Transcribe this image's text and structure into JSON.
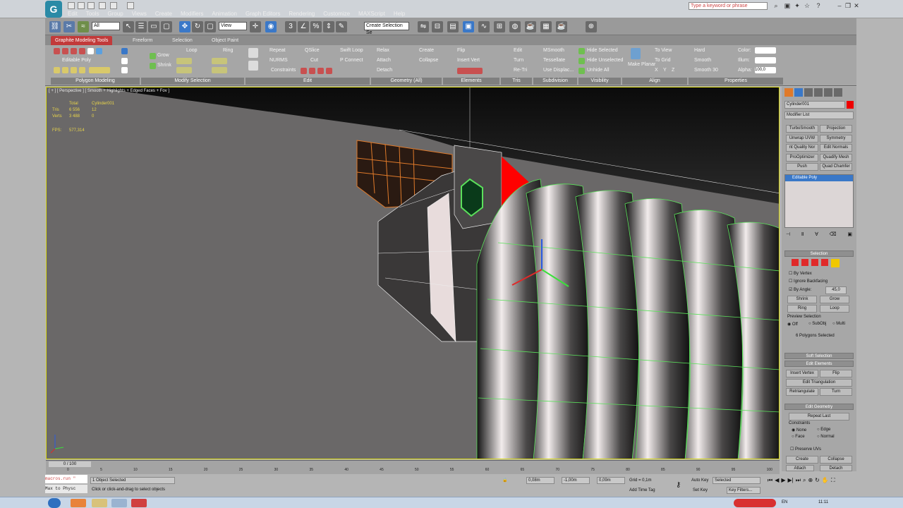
{
  "title_bar": {
    "search_placeholder": "Type a keyword or phrase",
    "app_letter": "G"
  },
  "menu": [
    "Edit",
    "Tools",
    "Group",
    "Views",
    "Create",
    "Modifiers",
    "Animation",
    "Graph Editors",
    "Rendering",
    "Customize",
    "MAXScript",
    "Help"
  ],
  "toolbar": {
    "filter_value": "All",
    "view_value": "View",
    "selection_set_value": "Create Selection Se"
  },
  "ribbon": {
    "tabs": [
      "Graphite Modeling Tools",
      "Freeform",
      "Selection",
      "Object Paint"
    ],
    "editable_poly_label": "Editable Poly",
    "panels": [
      "Polygon Modeling",
      "Modify Selection",
      "Edit",
      "Geometry (All)",
      "Elements",
      "Tris",
      "Subdivision",
      "Visibility",
      "Align",
      "Properties"
    ],
    "modify_sel": [
      "Grow",
      "Shrink",
      "Loop",
      "Ring"
    ],
    "edit": [
      "Repeat",
      "QSlice",
      "Swift Loop",
      "NURMS",
      "Cut",
      "P Connect",
      "Constraints"
    ],
    "geometry": [
      "Relax",
      "Create",
      "Attach",
      "Collapse",
      "Detach"
    ],
    "elements": [
      "Flip",
      "Insert Vert"
    ],
    "tris": [
      "Edit",
      "Turn",
      "Re-Tri"
    ],
    "subdivision": [
      "MSmooth",
      "Tessellate",
      "Use Displac..."
    ],
    "visibility": [
      "Hide Selected",
      "Hide Unselected",
      "Unhide All"
    ],
    "align": [
      "Make Planar"
    ],
    "align2": [
      "To View",
      "To Grid",
      "X",
      "Y",
      "Z"
    ],
    "properties": [
      "Hard",
      "Smooth",
      "Smooth 30",
      "Color:",
      "Illum:",
      "Alpha:"
    ],
    "alpha_value": "100,0"
  },
  "viewport": {
    "label": "[ + ] [ Perspective ] [ Smooth + Highlights + Edged Faces + Fov ]",
    "stats": {
      "total_label": "Total",
      "obj_label": "Cylinder001",
      "tris_label": "Tris",
      "tris_total": "6 556",
      "tris_obj": "12",
      "verts_label": "Verts",
      "verts_total": "3 488",
      "verts_obj": "0",
      "fps_label": "FPS:",
      "fps_value": "577,314"
    }
  },
  "command_panel": {
    "object_name": "Cylinder001",
    "modifier_list": "Modifier List",
    "modifier_buttons": [
      "TurboSmooth",
      "Projection",
      "Unwrap UVW",
      "Symmetry",
      "nt Quality Nor",
      "Edit Normals",
      "ProOptimizer",
      "Quadify Mesh",
      "Push",
      "Quad Chamfer"
    ],
    "stack_item": "Editable Poly",
    "selection_header": "Selection",
    "by_vertex": "By Vertex",
    "ignore_backfacing": "Ignore Backfacing",
    "by_angle": "By Angle:",
    "angle_value": "45,0",
    "shrink": "Shrink",
    "grow": "Grow",
    "ring": "Ring",
    "loop": "Loop",
    "preview_header": "Preview Selection",
    "preview_opts": [
      "Off",
      "SubObj",
      "Multi"
    ],
    "selected_info": "6 Polygons Selected",
    "soft_sel": "Soft Selection",
    "edit_elements": "Edit Elements",
    "insert_vertex": "Insert Vertex",
    "flip": "Flip",
    "edit_triangulation": "Edit Triangulation",
    "retriangulate": "Retriangulate",
    "turn": "Turn",
    "edit_geometry": "Edit Geometry",
    "repeat_last": "Repeat Last",
    "constraints": "Constraints",
    "con_opts": [
      "None",
      "Edge",
      "Face",
      "Normal"
    ],
    "preserve_uvs": "Preserve UVs",
    "create": "Create",
    "collapse": "Collapse",
    "attach": "Attach",
    "detach": "Detach"
  },
  "timeline": {
    "frame": "0 / 100",
    "ticks": [
      "0",
      "5",
      "10",
      "15",
      "20",
      "25",
      "30",
      "35",
      "40",
      "45",
      "50",
      "55",
      "60",
      "65",
      "70",
      "75",
      "80",
      "85",
      "90",
      "95",
      "100"
    ]
  },
  "status": {
    "script_line1": "macros.run \"",
    "script_line2": "Max to Physc",
    "selected": "1 Object Selected",
    "prompt": "Click or click-and-drag to select objects",
    "x": "0,08m",
    "y": "-1,00m",
    "z": "0,09m",
    "grid": "Grid = 0,1m",
    "add_time_tag": "Add Time Tag",
    "auto_key": "Auto Key",
    "set_key": "Set Key",
    "selected_dd": "Selected",
    "key_filters": "Key Filters..."
  },
  "taskbar": {
    "time": "11:11",
    "lang": "EN"
  }
}
